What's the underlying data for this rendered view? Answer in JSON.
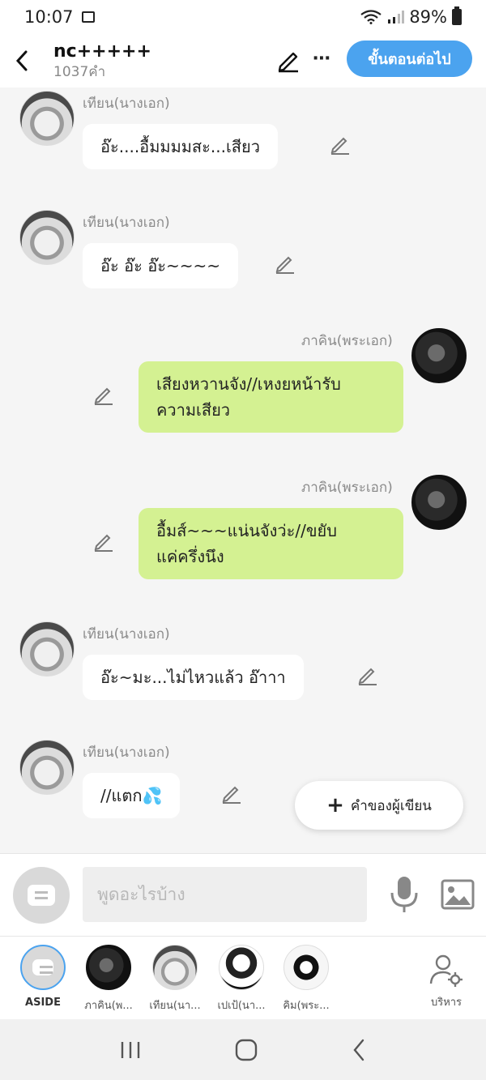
{
  "status_bar": {
    "time": "10:07",
    "battery": "89%"
  },
  "header": {
    "title": "nc+++++",
    "subtitle": "1037คำ",
    "next_label": "ขั้นตอนต่อไป"
  },
  "messages": [
    {
      "side": "left",
      "speaker": "เทียน(นางเอก)",
      "text": "อ๊ะ....อื้มมมมสะ...เสียว"
    },
    {
      "side": "left",
      "speaker": "เทียน(นางเอก)",
      "text": "อ๊ะ อ๊ะ อ๊ะ~~~~"
    },
    {
      "side": "right",
      "speaker": "ภาคิน(พระเอก)",
      "line1": "เสียงหวานจัง//เหงยหน้ารับ",
      "line2": "ความเสียว"
    },
    {
      "side": "right",
      "speaker": "ภาคิน(พระเอก)",
      "line1": "อื้มส์~~~แน่นจังว่ะ//ขยับ",
      "line2": "แค่ครึ่งนึง"
    },
    {
      "side": "left",
      "speaker": "เทียน(นางเอก)",
      "text": "อ๊ะ~มะ...ไม่ไหวแล้ว อ๊าาา"
    },
    {
      "side": "left",
      "speaker": "เทียน(นางเอก)",
      "text": "//แตก💦"
    }
  ],
  "aside_button": {
    "label": "คำของผู้เขียน"
  },
  "composer": {
    "placeholder": "พูดอะไรบ้าง"
  },
  "characters": [
    {
      "label": "ASIDE"
    },
    {
      "label": "ภาคิน(พ..."
    },
    {
      "label": "เทียน(นา..."
    },
    {
      "label": "เปเป้(นา..."
    },
    {
      "label": "คิม(พระ..."
    }
  ],
  "manage": {
    "label": "บริหาร"
  },
  "colors": {
    "accent": "#4ba3ef",
    "right_bubble": "#d4f192",
    "left_bubble": "#ffffff"
  }
}
